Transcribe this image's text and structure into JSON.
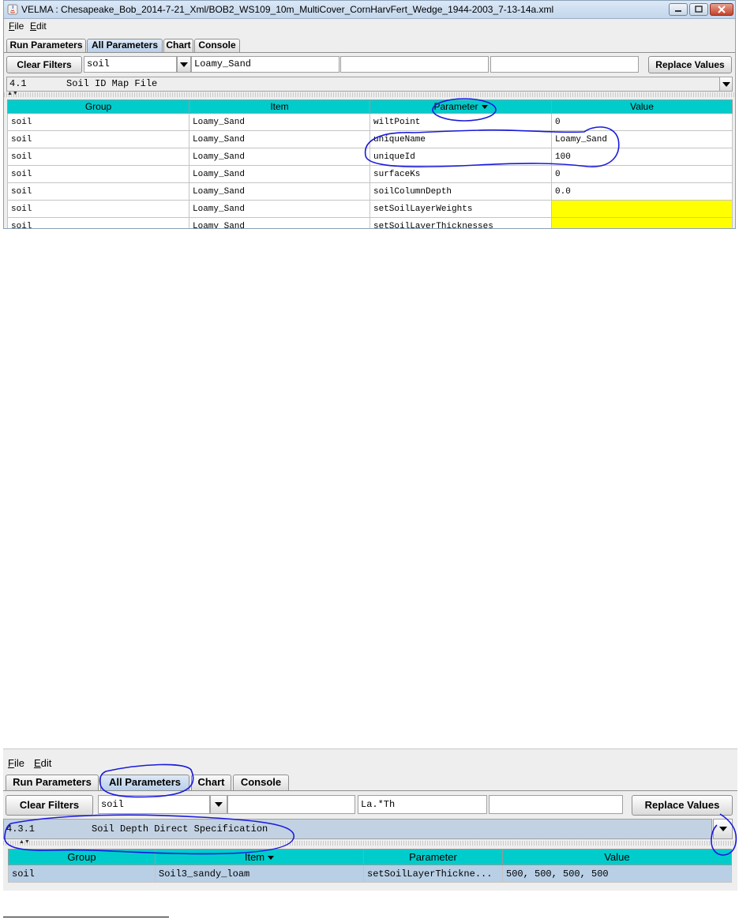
{
  "screenshot1": {
    "window_title": "VELMA : Chesapeake_Bob_2014-7-21_Xml/BOB2_WS109_10m_MultiCover_CornHarvFert_Wedge_1944-2003_7-13-14a.xml",
    "window_controls": {
      "minimize": "minimize-icon",
      "maximize": "maximize-icon",
      "close": "close-icon"
    },
    "menus": {
      "file": "File",
      "edit": "Edit"
    },
    "tabs": {
      "run_parameters": "Run Parameters",
      "all_parameters": "All Parameters",
      "chart": "Chart",
      "console": "Console"
    },
    "active_tab": "All Parameters",
    "toolbar": {
      "clear_filters": "Clear Filters",
      "group_filter": "soil",
      "item_filter": "Loamy_Sand",
      "parameter_filter": "",
      "value_filter": "",
      "replace_values": "Replace Values"
    },
    "category": "4.1       Soil ID Map File",
    "table": {
      "headers": {
        "group": "Group",
        "item": "Item",
        "parameter": "Parameter",
        "value": "Value"
      },
      "sorted_column": "Parameter",
      "rows": [
        {
          "group": "soil",
          "item": "Loamy_Sand",
          "parameter": "wiltPoint",
          "value": "0"
        },
        {
          "group": "soil",
          "item": "Loamy_Sand",
          "parameter": "uniqueName",
          "value": "Loamy_Sand"
        },
        {
          "group": "soil",
          "item": "Loamy_Sand",
          "parameter": "uniqueId",
          "value": "100"
        },
        {
          "group": "soil",
          "item": "Loamy_Sand",
          "parameter": "surfaceKs",
          "value": "0"
        },
        {
          "group": "soil",
          "item": "Loamy_Sand",
          "parameter": "soilColumnDepth",
          "value": "0.0"
        },
        {
          "group": "soil",
          "item": "Loamy_Sand",
          "parameter": "setSoilLayerWeights",
          "value": ""
        },
        {
          "group": "soil",
          "item": "Loamy_Sand",
          "parameter": "setSoilLayerThicknesses",
          "value": ""
        }
      ],
      "highlight_color": "#ffff00"
    }
  },
  "screenshot2": {
    "menus": {
      "file": "File",
      "edit": "Edit"
    },
    "tabs": {
      "run_parameters": "Run Parameters",
      "all_parameters": "All Parameters",
      "chart": "Chart",
      "console": "Console"
    },
    "active_tab": "All Parameters",
    "toolbar": {
      "clear_filters": "Clear Filters",
      "group_filter": "soil",
      "item_filter": "",
      "parameter_filter": "La.*Th",
      "value_filter": "",
      "replace_values": "Replace Values"
    },
    "category": "4.3.1          Soil Depth Direct Specification",
    "table": {
      "headers": {
        "group": "Group",
        "item": "Item",
        "parameter": "Parameter",
        "value": "Value"
      },
      "sorted_column": "Item",
      "rows": [
        {
          "group": "soil",
          "item": "Soil3_sandy_loam",
          "parameter": "setSoilLayerThickne...",
          "value": "500, 500, 500, 500"
        }
      ]
    }
  },
  "colors": {
    "header_teal": "#00cccc",
    "annotation_blue": "#1a1adc",
    "selected_row": "#b8cfe5",
    "active_tab": "#b8cfea"
  }
}
